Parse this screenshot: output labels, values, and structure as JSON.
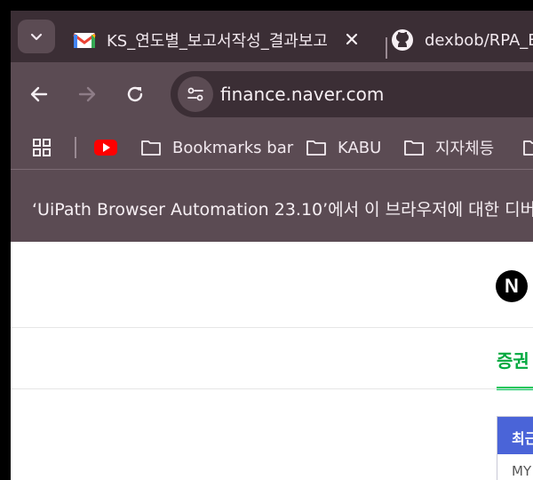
{
  "tabs": {
    "active": {
      "title": "KS_연도별_보고서작성_결과보고",
      "icon": "gmail-icon"
    },
    "inactive": {
      "title": "dexbob/RPA_Ex",
      "icon": "github-icon"
    }
  },
  "toolbar": {
    "url": "finance.naver.com"
  },
  "bookmarks": {
    "items": [
      {
        "label": "Bookmarks bar"
      },
      {
        "label": "KABU"
      },
      {
        "label": "지자체등"
      }
    ]
  },
  "infobar": {
    "text": "‘UiPath Browser Automation 23.10’에서 이 브라우저에 대한 디버"
  },
  "page": {
    "logo_letter": "N",
    "nav_tab": "증권",
    "panel_header": "최근",
    "panel_row": "MY"
  },
  "colors": {
    "chrome_dark": "#3b2e35",
    "chrome_mid": "#5b4b53",
    "naver_green": "#03c75a",
    "panel_blue": "#4a64d8"
  }
}
